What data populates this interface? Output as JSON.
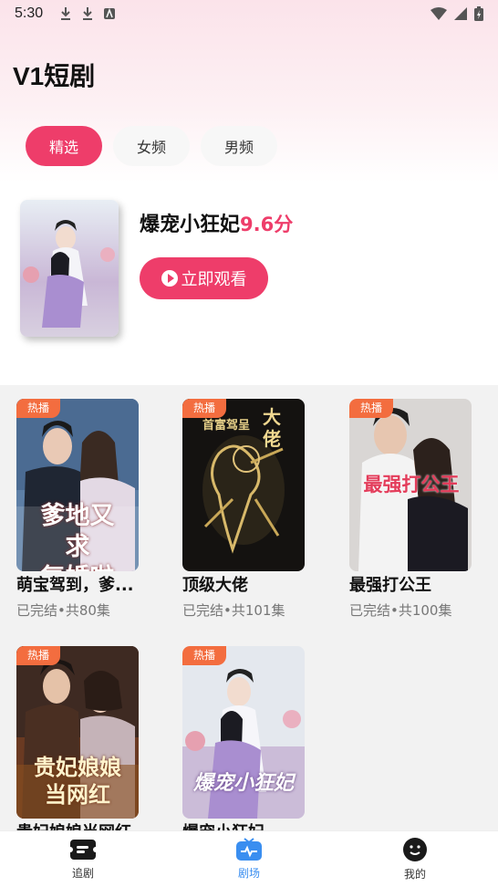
{
  "status_bar": {
    "time": "5:30"
  },
  "app": {
    "title": "V1短剧"
  },
  "tabs": [
    {
      "label": "精选",
      "active": true
    },
    {
      "label": "女频",
      "active": false
    },
    {
      "label": "男频",
      "active": false
    }
  ],
  "featured": {
    "title": "爆宠小狂妃",
    "score": "9.6分",
    "watch_label": "立即观看"
  },
  "dramas": [
    {
      "badge": "热播",
      "name": "萌宝驾到，爹...",
      "meta": "已完结•共80集"
    },
    {
      "badge": "热播",
      "name": "顶级大佬",
      "meta": "已完结•共101集"
    },
    {
      "badge": "热播",
      "name": "最强打公王",
      "meta": "已完结•共100集"
    },
    {
      "badge": "热播",
      "name": "贵妃娘娘当网红",
      "meta": ""
    },
    {
      "badge": "热播",
      "name": "爆宠小狂妃",
      "meta": ""
    }
  ],
  "bottom_nav": [
    {
      "label": "追剧",
      "icon": "ticket-icon",
      "active": false
    },
    {
      "label": "剧场",
      "icon": "tv-icon",
      "active": true
    },
    {
      "label": "我的",
      "icon": "smiley-icon",
      "active": false
    }
  ],
  "colors": {
    "accent": "#ee3d6a",
    "badge": "#f36d3f",
    "nav_active": "#3a8ef0"
  }
}
